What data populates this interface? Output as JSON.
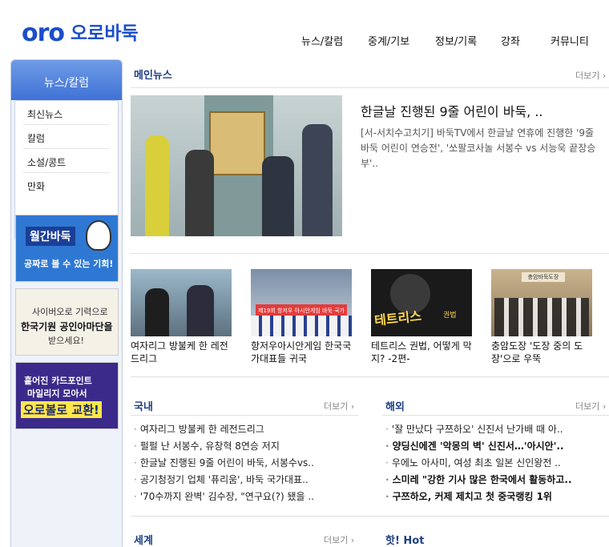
{
  "header": {
    "logo_mark": "oro",
    "logo_text": "오로바둑",
    "nav": [
      "뉴스/칼럼",
      "중계/기보",
      "정보/기록",
      "강좌",
      "커뮤니티"
    ]
  },
  "sidebar": {
    "title": "뉴스/칼럼",
    "menu": [
      "최신뉴스",
      "칼럼",
      "소설/콩트",
      "만화"
    ],
    "banners": {
      "b1_title": "월간바둑",
      "b1_sub": "공짜로 볼 수 있는 기회!",
      "b2_l1": "사이버오로 기력으로",
      "b2_l2": "한국기원 공인아마단을",
      "b2_l3": "받으세요!",
      "b3_l1": "흩어진 카드포인트",
      "b3_l2": "마일리지 모아서",
      "b3_l3": "오로볼로 교환!"
    }
  },
  "main_news": {
    "title": "메인뉴스",
    "more": "더보기 ›",
    "headline": "한글날 진행된 9줄 어린이 바둑, ..",
    "summary": "[서-서치수고치기] 바둑TV에서 한글날 연휴에 진행한 '9줄 바둑 어린이 연승전', '쏘팔코사놀 서봉수 vs 서능욱 끝장승부'.."
  },
  "thumbs": [
    {
      "caption": "여자리그 방불케 한 레전드리그"
    },
    {
      "caption": "항저우아시안게임 한국국가대표들 귀국",
      "banner": "제19회 항저우 아시안게임 바둑 국가대표"
    },
    {
      "caption": "테트리스 권법, 어떻게 막지? -2편-",
      "logo": "테트리스",
      "logo_sub": "권법"
    },
    {
      "caption": "충암도장 '도장 중의 도장'으로 우뚝",
      "sign": "충암바둑도장"
    }
  ],
  "domestic": {
    "title": "국내",
    "more": "더보기 ›",
    "items": [
      "여자리그 방불케 한 레전드리그",
      "펄펄 난 서봉수, 유창혁 8연승 저지",
      "한글날 진행된 9줄 어린이 바둑, 서봉수vs..",
      "공기청정기 업체 '퓨리움', 바둑 국가대표..",
      "'70수까지 완벽' 김수장, \"연구요(?) 됐을 .."
    ]
  },
  "overseas": {
    "title": "해외",
    "more": "더보기 ›",
    "items": [
      {
        "text": "'잘 만났다 구쯔하오' 신진서 난가배 때 아..",
        "bold": false
      },
      {
        "text": "양딩신에겐 '악몽의 벽' 신진서…'아시안'..",
        "bold": true
      },
      {
        "text": "우에노 아사미, 여성 최초 일본 신인왕전 ..",
        "bold": false
      },
      {
        "text": "스미레 \"강한 기사 많은 한국에서 활동하고..",
        "bold": true
      },
      {
        "text": "구쯔하오, 커제 제치고 첫 중국랭킹 1위",
        "bold": true
      }
    ]
  },
  "world": {
    "title": "세계",
    "more": "더보기 ›"
  },
  "hot": {
    "title": "핫! Hot"
  }
}
